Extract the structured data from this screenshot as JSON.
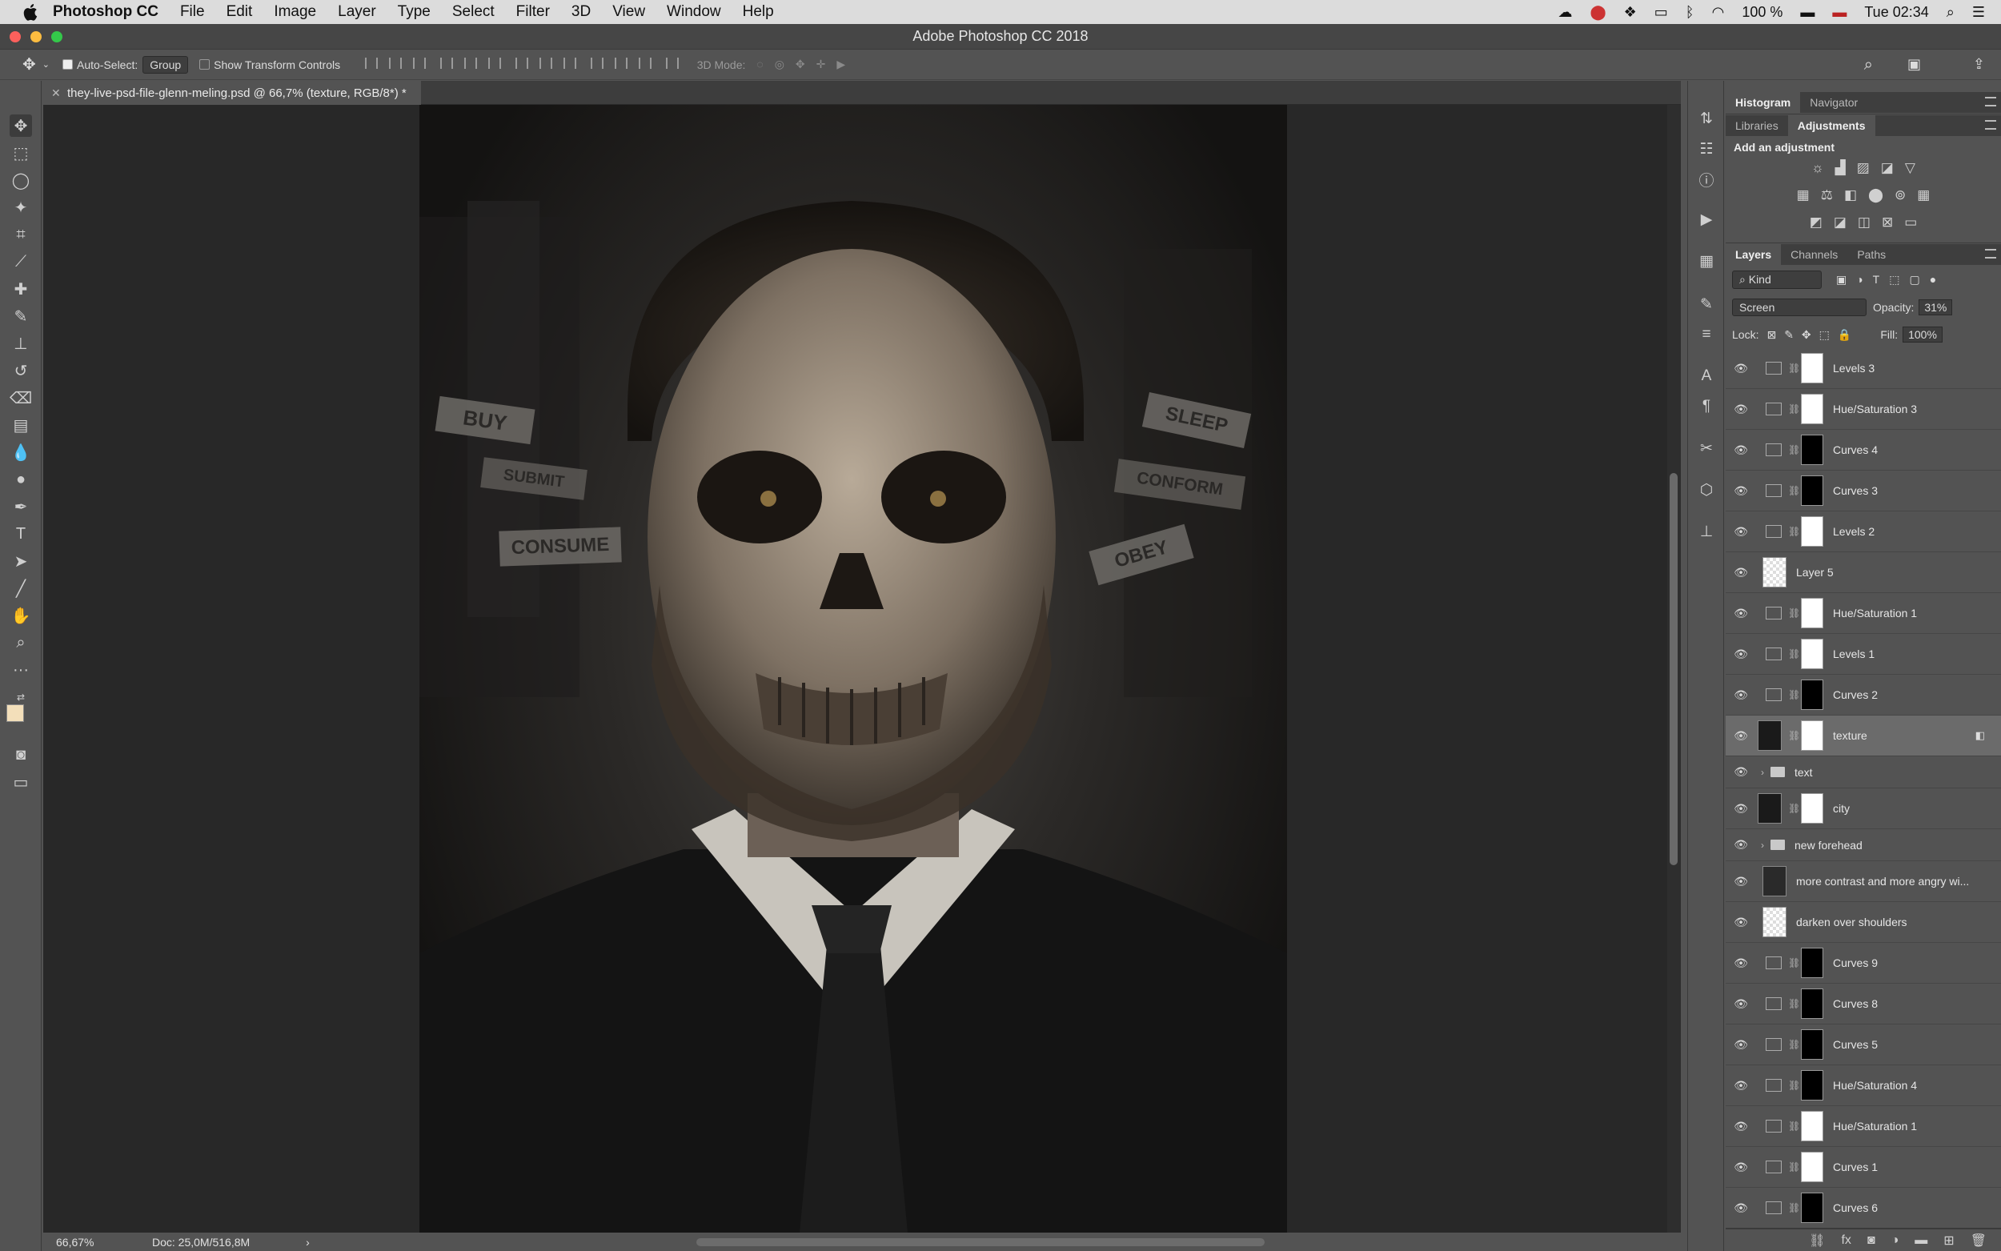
{
  "menubar": {
    "app": "Photoshop CC",
    "items": [
      "File",
      "Edit",
      "Image",
      "Layer",
      "Type",
      "Select",
      "Filter",
      "3D",
      "View",
      "Window",
      "Help"
    ],
    "battery": "100 %",
    "clock": "Tue 02:34"
  },
  "window": {
    "title": "Adobe Photoshop CC 2018"
  },
  "options": {
    "auto_select_label": "Auto-Select:",
    "auto_select_value": "Group",
    "transform_label": "Show Transform Controls",
    "mode3d_label": "3D Mode:"
  },
  "document": {
    "tab_title": "they-live-psd-file-glenn-meling.psd @ 66,7% (texture, RGB/8*) *"
  },
  "artwork": {
    "words": [
      "BUY",
      "SUBMIT",
      "CONSUME",
      "SLEEP",
      "CONFORM",
      "OBEY"
    ]
  },
  "status": {
    "zoom": "66,67%",
    "doc": "Doc: 25,0M/516,8M"
  },
  "panels": {
    "top_tabs": [
      "Histogram",
      "Navigator"
    ],
    "adj_tabs": [
      "Libraries",
      "Adjustments"
    ],
    "adj_title": "Add an adjustment",
    "layer_tabs": [
      "Layers",
      "Channels",
      "Paths"
    ],
    "kind": "Kind",
    "blend_mode": "Screen",
    "opacity_label": "Opacity:",
    "opacity_value": "31%",
    "lock_label": "Lock:",
    "fill_label": "Fill:",
    "fill_value": "100%"
  },
  "layers": [
    {
      "name": "Levels 3",
      "type": "adj",
      "mask": "white"
    },
    {
      "name": "Hue/Saturation 3",
      "type": "adj",
      "mask": "white"
    },
    {
      "name": "Curves 4",
      "type": "adj",
      "mask": "black"
    },
    {
      "name": "Curves 3",
      "type": "adj",
      "mask": "black"
    },
    {
      "name": "Levels 2",
      "type": "adj",
      "mask": "white"
    },
    {
      "name": "Layer 5",
      "type": "pixel",
      "mask": "checker"
    },
    {
      "name": "Hue/Saturation 1",
      "type": "adj",
      "mask": "white"
    },
    {
      "name": "Levels 1",
      "type": "adj",
      "mask": "white"
    },
    {
      "name": "Curves 2",
      "type": "adj",
      "mask": "black"
    },
    {
      "name": "texture",
      "type": "pixel-mask",
      "mask": "white",
      "selected": true
    },
    {
      "name": "text",
      "type": "group"
    },
    {
      "name": "city",
      "type": "pixel-mask",
      "mask": "white"
    },
    {
      "name": "new forehead",
      "type": "group"
    },
    {
      "name": "more contrast and more angry wi...",
      "type": "pixel",
      "mask": "dark"
    },
    {
      "name": "darken over shoulders",
      "type": "pixel",
      "mask": "checker"
    },
    {
      "name": "Curves 9",
      "type": "adj",
      "mask": "black"
    },
    {
      "name": "Curves 8",
      "type": "adj",
      "mask": "black"
    },
    {
      "name": "Curves 5",
      "type": "adj",
      "mask": "black"
    },
    {
      "name": "Hue/Saturation 4",
      "type": "adj",
      "mask": "black"
    },
    {
      "name": "Hue/Saturation 1",
      "type": "adj",
      "mask": "white"
    },
    {
      "name": "Curves 1",
      "type": "adj",
      "mask": "white"
    },
    {
      "name": "Curves 6",
      "type": "adj",
      "mask": "black"
    }
  ]
}
